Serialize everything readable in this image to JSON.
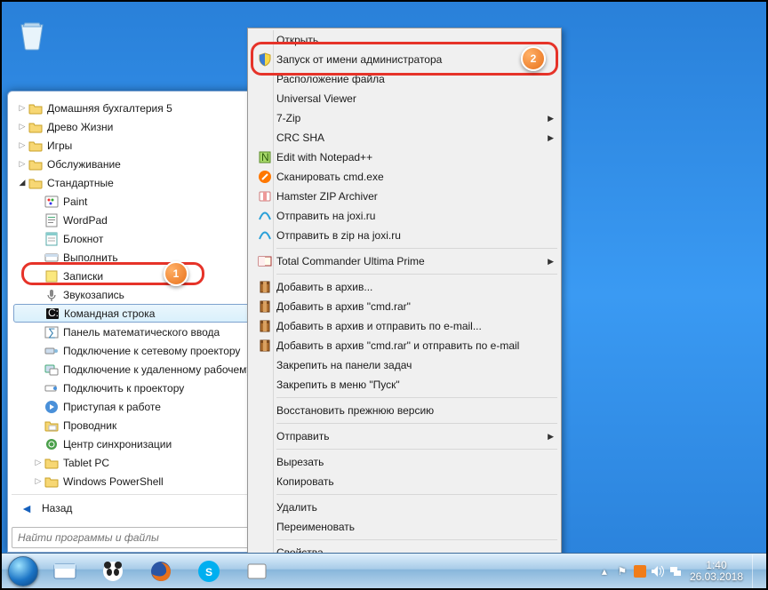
{
  "start_menu": {
    "items": [
      {
        "label": "Домашняя бухгалтерия 5",
        "icon": "folder",
        "indent": 0,
        "expanded": false
      },
      {
        "label": "Древо Жизни",
        "icon": "folder",
        "indent": 0,
        "expanded": false
      },
      {
        "label": "Игры",
        "icon": "folder",
        "indent": 0,
        "expanded": false
      },
      {
        "label": "Обслуживание",
        "icon": "folder",
        "indent": 0,
        "expanded": false
      },
      {
        "label": "Стандартные",
        "icon": "folder",
        "indent": 0,
        "expanded": true
      },
      {
        "label": "Paint",
        "icon": "paint",
        "indent": 1
      },
      {
        "label": "WordPad",
        "icon": "wordpad",
        "indent": 1
      },
      {
        "label": "Блокнот",
        "icon": "notepad",
        "indent": 1
      },
      {
        "label": "Выполнить",
        "icon": "run",
        "indent": 1
      },
      {
        "label": "Записки",
        "icon": "sticky",
        "indent": 1
      },
      {
        "label": "Звукозапись",
        "icon": "mic",
        "indent": 1
      },
      {
        "label": "Командная строка",
        "icon": "cmd",
        "indent": 1,
        "selected": true
      },
      {
        "label": "Панель математического ввода",
        "icon": "math",
        "indent": 1
      },
      {
        "label": "Подключение к сетевому проектору",
        "icon": "netproj",
        "indent": 1
      },
      {
        "label": "Подключение к удаленному рабочему столу",
        "icon": "rdp",
        "indent": 1
      },
      {
        "label": "Подключить к проектору",
        "icon": "proj",
        "indent": 1
      },
      {
        "label": "Приступая к работе",
        "icon": "getstarted",
        "indent": 1
      },
      {
        "label": "Проводник",
        "icon": "explorer",
        "indent": 1
      },
      {
        "label": "Центр синхронизации",
        "icon": "sync",
        "indent": 1
      },
      {
        "label": "Tablet PC",
        "icon": "folder",
        "indent": 1,
        "expanded": false
      },
      {
        "label": "Windows PowerShell",
        "icon": "folder",
        "indent": 1,
        "expanded": false
      }
    ],
    "back_label": "Назад",
    "search_placeholder": "Найти программы и файлы"
  },
  "context_menu": {
    "groups": [
      [
        {
          "label": "Открыть",
          "icon": ""
        },
        {
          "label": "Запуск от имени администратора",
          "icon": "shield",
          "highlight": true
        },
        {
          "label": "Расположение файла",
          "icon": ""
        },
        {
          "label": "Universal Viewer",
          "icon": ""
        },
        {
          "label": "7-Zip",
          "icon": "",
          "submenu": true
        },
        {
          "label": "CRC SHA",
          "icon": "",
          "submenu": true
        },
        {
          "label": "Edit with Notepad++",
          "icon": "npp"
        },
        {
          "label": "Сканировать cmd.exe",
          "icon": "avast"
        },
        {
          "label": "Hamster ZIP Archiver",
          "icon": "hamster"
        },
        {
          "label": "Отправить на joxi.ru",
          "icon": "joxi"
        },
        {
          "label": "Отправить в zip на joxi.ru",
          "icon": "joxi"
        }
      ],
      [
        {
          "label": "Total Commander Ultima Prime",
          "icon": "tc",
          "submenu": true
        }
      ],
      [
        {
          "label": "Добавить в архив...",
          "icon": "rar"
        },
        {
          "label": "Добавить в архив \"cmd.rar\"",
          "icon": "rar"
        },
        {
          "label": "Добавить в архив и отправить по e-mail...",
          "icon": "rar"
        },
        {
          "label": "Добавить в архив \"cmd.rar\" и отправить по e-mail",
          "icon": "rar"
        },
        {
          "label": "Закрепить на панели задач",
          "icon": ""
        },
        {
          "label": "Закрепить в меню \"Пуск\"",
          "icon": ""
        }
      ],
      [
        {
          "label": "Восстановить прежнюю версию",
          "icon": ""
        }
      ],
      [
        {
          "label": "Отправить",
          "icon": "",
          "submenu": true
        }
      ],
      [
        {
          "label": "Вырезать",
          "icon": ""
        },
        {
          "label": "Копировать",
          "icon": ""
        }
      ],
      [
        {
          "label": "Удалить",
          "icon": ""
        },
        {
          "label": "Переименовать",
          "icon": ""
        }
      ],
      [
        {
          "label": "Свойства",
          "icon": ""
        }
      ]
    ]
  },
  "badges": {
    "one": "1",
    "two": "2"
  },
  "taskbar": {
    "time": "1:40",
    "date": "26.03.2018"
  }
}
